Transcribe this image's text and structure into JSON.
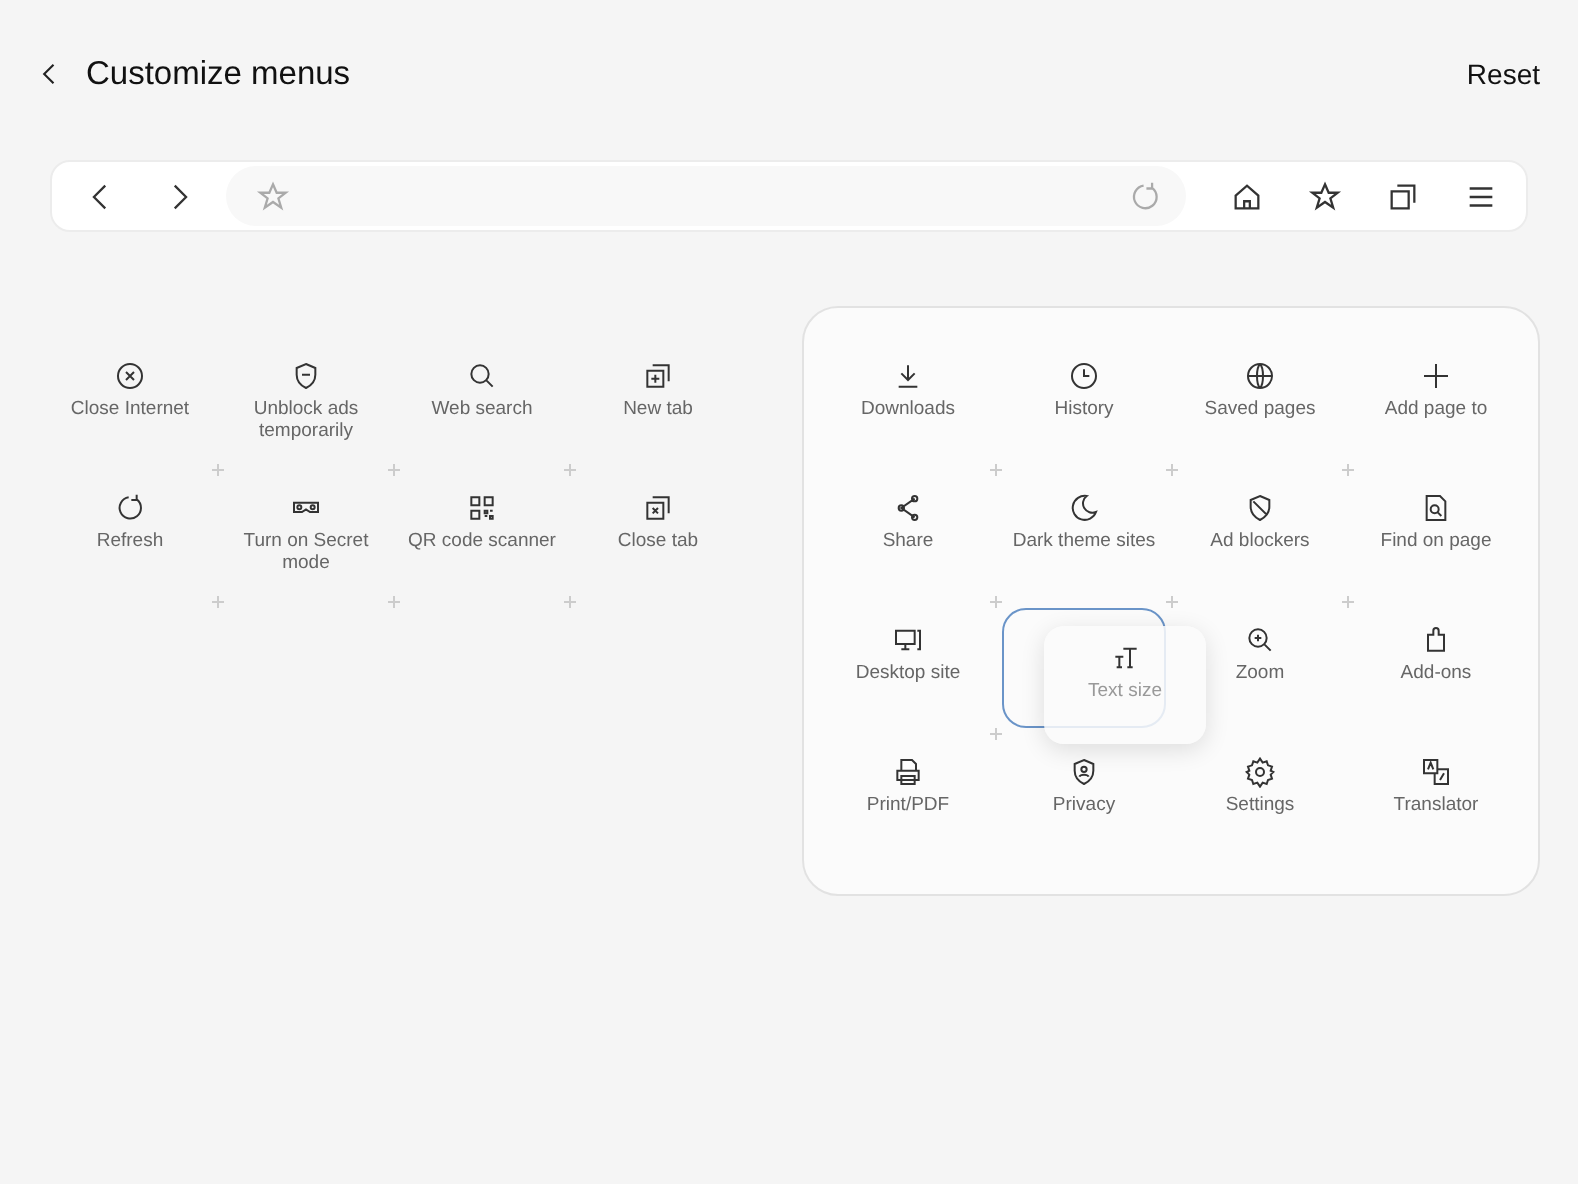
{
  "header": {
    "title": "Customize menus",
    "reset": "Reset"
  },
  "available_items": [
    {
      "label": "Close Internet"
    },
    {
      "label": "Unblock ads temporarily"
    },
    {
      "label": "Web search"
    },
    {
      "label": "New tab"
    },
    {
      "label": "Refresh"
    },
    {
      "label": "Turn on Secret mode"
    },
    {
      "label": "QR code scanner"
    },
    {
      "label": "Close tab"
    }
  ],
  "menu_items": [
    {
      "kind": "item",
      "label": "Downloads"
    },
    {
      "kind": "item",
      "label": "History"
    },
    {
      "kind": "item",
      "label": "Saved pages"
    },
    {
      "kind": "item",
      "label": "Add page to"
    },
    {
      "kind": "item",
      "label": "Share"
    },
    {
      "kind": "item",
      "label": "Dark theme sites"
    },
    {
      "kind": "item",
      "label": "Ad blockers"
    },
    {
      "kind": "item",
      "label": "Find on page"
    },
    {
      "kind": "item",
      "label": "Desktop site"
    },
    {
      "kind": "drop_slot"
    },
    {
      "kind": "item",
      "label": "Zoom"
    },
    {
      "kind": "item",
      "label": "Add-ons"
    },
    {
      "kind": "item",
      "label": "Print/PDF"
    },
    {
      "kind": "item",
      "label": "Privacy"
    },
    {
      "kind": "item",
      "label": "Settings"
    },
    {
      "kind": "item",
      "label": "Translator"
    }
  ],
  "dragged_item": {
    "label": "Text size"
  }
}
